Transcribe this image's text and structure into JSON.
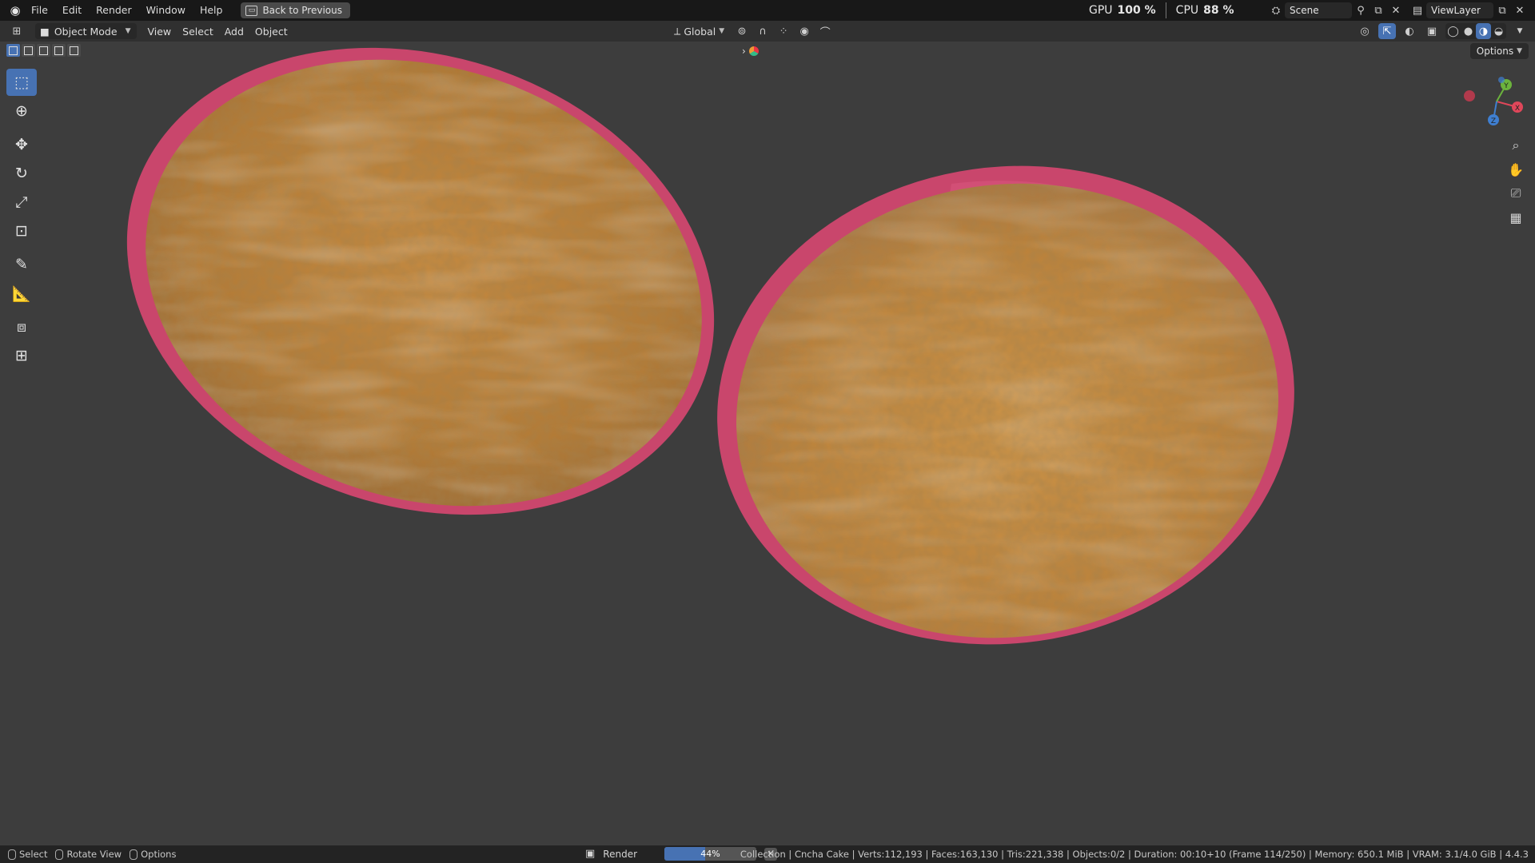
{
  "topbar": {
    "menu": [
      "File",
      "Edit",
      "Render",
      "Window",
      "Help"
    ],
    "back_button": "Back to Previous",
    "gpu_label": "GPU",
    "gpu_value": "100 %",
    "cpu_label": "CPU",
    "cpu_value": "88 %",
    "scene": "Scene",
    "view_layer": "ViewLayer"
  },
  "header": {
    "mode": "Object Mode",
    "menus": [
      "View",
      "Select",
      "Add",
      "Object"
    ],
    "transform_orientation": "Global",
    "options": "Options"
  },
  "statusbar": {
    "select": "Select",
    "rotate_view": "Rotate View",
    "options": "Options",
    "render_label": "Render",
    "render_progress": 0.44,
    "render_progress_text": "44%",
    "stats": "Collection | Cncha Cake | Verts:112,193 | Faces:163,130 | Tris:221,338 | Objects:0/2 | Duration: 00:10+10 (Frame 114/250) | Memory: 650.1 MiB | VRAM: 3.1/4.0 GiB | 4.4.3"
  },
  "gizmo": {
    "x_label": "X",
    "y_label": "Y",
    "z_label": "Z"
  },
  "colors": {
    "accent": "#4772b3",
    "viewport_bg": "#3d3d3d",
    "cake_top": "#c8893c",
    "cake_rim": "#d94f78"
  }
}
